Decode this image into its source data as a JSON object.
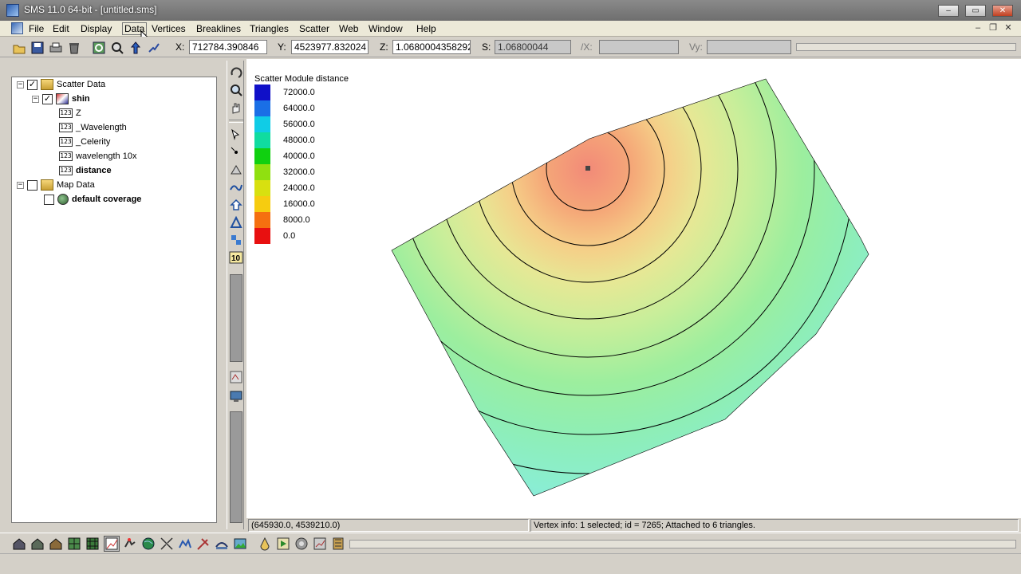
{
  "window": {
    "title": "SMS 11.0 64-bit - [untitled.sms]"
  },
  "menu": {
    "items": [
      "File",
      "Edit",
      "Display",
      "Data",
      "Vertices",
      "Breaklines",
      "Triangles",
      "Scatter",
      "Web",
      "Window",
      "Help"
    ]
  },
  "coords": {
    "x_label": "X:",
    "x_value": "712784.390846",
    "y_label": "Y:",
    "y_value": "4523977.832024",
    "z_label": "Z:",
    "z_value": "1.0680004358292",
    "s_label": "S:",
    "s_value": "1.06800044",
    "dx_label": "/X:",
    "dy_label": "Vy:"
  },
  "tree": {
    "scatter_data": "Scatter Data",
    "shin": "shin",
    "z": "Z",
    "wavelength": "_Wavelength",
    "celerity": "_Celerity",
    "wavelength10x": "wavelength 10x",
    "distance": "distance",
    "map_data": "Map Data",
    "default_coverage": "default coverage"
  },
  "legend": {
    "title": "Scatter Module distance",
    "entries": [
      {
        "label": "72000.0",
        "color": "#1010c8"
      },
      {
        "label": "64000.0",
        "color": "#1a6fe6"
      },
      {
        "label": "56000.0",
        "color": "#10cce6"
      },
      {
        "label": "48000.0",
        "color": "#10dca0"
      },
      {
        "label": "40000.0",
        "color": "#10d010"
      },
      {
        "label": "32000.0",
        "color": "#90e010"
      },
      {
        "label": "24000.0",
        "color": "#d8e010"
      },
      {
        "label": "16000.0",
        "color": "#f6cc10"
      },
      {
        "label": "8000.0",
        "color": "#f57010"
      },
      {
        "label": "0.0",
        "color": "#e81010"
      }
    ]
  },
  "status": {
    "cursor": "(645930.0, 4539210.0)",
    "vertex_info": "Vertex info: 1 selected; id = 7265; Attached to 6 triangles."
  }
}
